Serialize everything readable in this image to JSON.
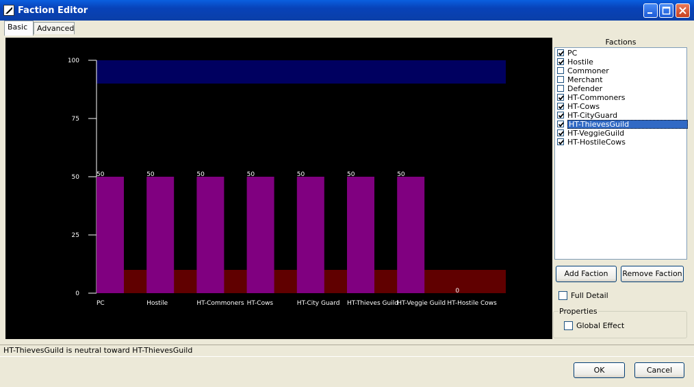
{
  "window": {
    "title": "Faction Editor"
  },
  "tabs": [
    {
      "label": "Basic"
    },
    {
      "label": "Advanced"
    }
  ],
  "factions_panel": {
    "header": "Factions",
    "items": [
      {
        "label": "PC",
        "checked": true,
        "selected": false
      },
      {
        "label": "Hostile",
        "checked": true,
        "selected": false
      },
      {
        "label": "Commoner",
        "checked": false,
        "selected": false
      },
      {
        "label": "Merchant",
        "checked": false,
        "selected": false
      },
      {
        "label": "Defender",
        "checked": false,
        "selected": false
      },
      {
        "label": "HT-Commoners",
        "checked": true,
        "selected": false
      },
      {
        "label": "HT-Cows",
        "checked": true,
        "selected": false
      },
      {
        "label": "HT-CityGuard",
        "checked": true,
        "selected": false
      },
      {
        "label": "HT-ThievesGuild",
        "checked": true,
        "selected": true
      },
      {
        "label": "HT-VeggieGuild",
        "checked": true,
        "selected": false
      },
      {
        "label": "HT-HostileCows",
        "checked": true,
        "selected": false
      }
    ],
    "add_button": "Add Faction",
    "remove_button": "Remove Faction",
    "full_detail_label": "Full Detail",
    "properties_label": "Properties",
    "global_effect_label": "Global Effect"
  },
  "status_text": "HT-ThievesGuild  is neutral toward HT-ThievesGuild",
  "ok_button": "OK",
  "cancel_button": "Cancel",
  "colors": {
    "chart_bg": "#000000",
    "bar": "#800080",
    "hostile_band": "#600000",
    "friendly_band": "#000060",
    "axis": "#ffffff",
    "selection": "#316ac5"
  },
  "chart_data": {
    "type": "bar",
    "categories": [
      "PC",
      "Hostile",
      "HT-Commoners",
      "HT-Cows",
      "HT-City Guard",
      "HT-Thieves Guild",
      "HT-Veggie Guild",
      "HT-Hostile Cows"
    ],
    "values": [
      50,
      50,
      50,
      50,
      50,
      50,
      50,
      0
    ],
    "value_labels": [
      "50",
      "50",
      "50",
      "50",
      "50",
      "50",
      "50",
      "0"
    ],
    "ylim": [
      0,
      100
    ],
    "yticks": [
      "0",
      "25",
      "50",
      "75",
      "100"
    ],
    "bands": [
      {
        "from": 0,
        "to": 10,
        "color": "#600000"
      },
      {
        "from": 90,
        "to": 100,
        "color": "#000060"
      }
    ],
    "grid": false
  }
}
